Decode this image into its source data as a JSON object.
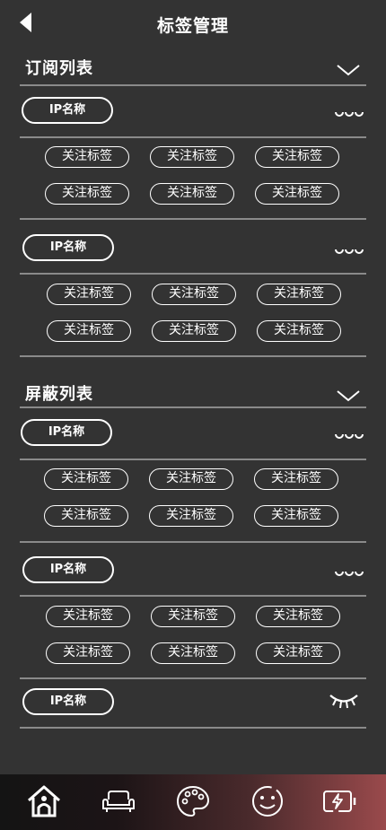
{
  "header": {
    "title": "标签管理"
  },
  "subscribe": {
    "title": "订阅列表",
    "groups": [
      {
        "ip_label": "IP名称",
        "tags": [
          "关注标签",
          "关注标签",
          "关注标签",
          "关注标签",
          "关注标签",
          "关注标签"
        ]
      },
      {
        "ip_label": "IP名称",
        "tags": [
          "关注标签",
          "关注标签",
          "关注标签",
          "关注标签",
          "关注标签",
          "关注标签"
        ]
      }
    ]
  },
  "blocked": {
    "title": "屏蔽列表",
    "groups": [
      {
        "ip_label": "IP名称",
        "tags": [
          "关注标签",
          "关注标签",
          "关注标签",
          "关注标签",
          "关注标签",
          "关注标签"
        ]
      },
      {
        "ip_label": "IP名称",
        "tags": [
          "关注标签",
          "关注标签",
          "关注标签",
          "关注标签",
          "关注标签",
          "关注标签"
        ]
      }
    ],
    "collapsed_item": {
      "ip_label": "IP名称"
    }
  },
  "icons": {
    "back": "back-arrow-icon",
    "collapse": "chevron-down-icon",
    "more": "more-dots-icon",
    "hidden": "closed-eye-icon",
    "nav": [
      "home-icon",
      "sofa-icon",
      "palette-icon",
      "smiley-icon",
      "battery-charging-icon"
    ]
  },
  "colors": {
    "background": "#333333",
    "divider": "#8a8a8a",
    "nav_gradient_start": "#141414",
    "nav_gradient_end": "#9a4a4c",
    "foreground": "#ffffff"
  }
}
